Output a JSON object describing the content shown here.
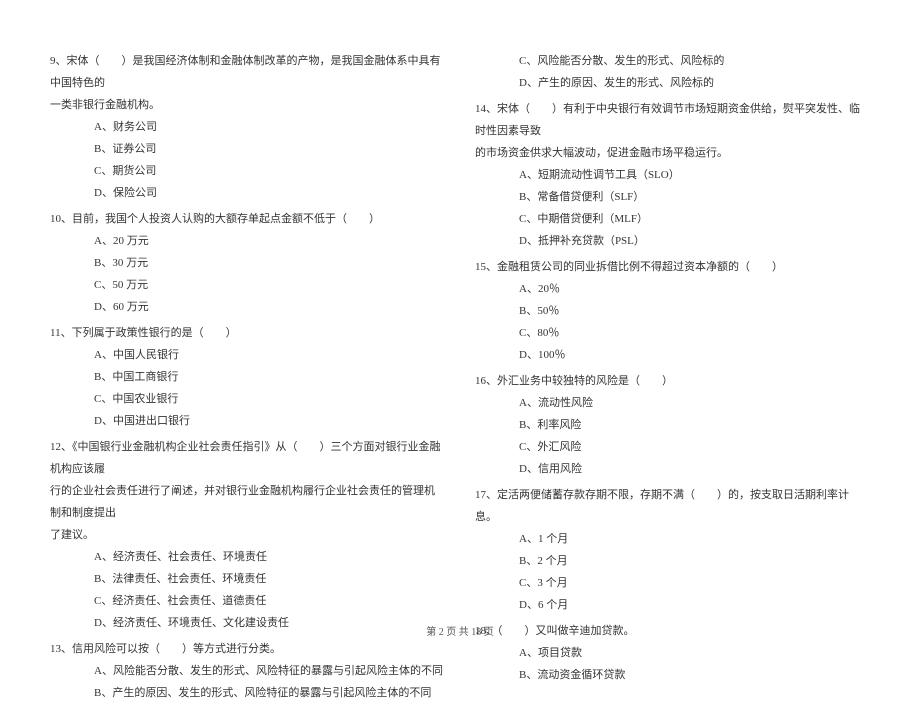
{
  "left": {
    "q9": {
      "stem": "9、宋体（　　）是我国经济体制和金融体制改革的产物，是我国金融体系中具有中国特色的",
      "stem2": "一类非银行金融机构。",
      "a": "A、财务公司",
      "b": "B、证券公司",
      "c": "C、期货公司",
      "d": "D、保险公司"
    },
    "q10": {
      "stem": "10、目前，我国个人投资人认购的大额存单起点金额不低于（　　）",
      "a": "A、20 万元",
      "b": "B、30 万元",
      "c": "C、50 万元",
      "d": "D、60 万元"
    },
    "q11": {
      "stem": "11、下列属于政策性银行的是（　　）",
      "a": "A、中国人民银行",
      "b": "B、中国工商银行",
      "c": "C、中国农业银行",
      "d": "D、中国进出口银行"
    },
    "q12": {
      "stem": "12、《中国银行业金融机构企业社会责任指引》从（　　）三个方面对银行业金融机构应该履",
      "stem2": "行的企业社会责任进行了阐述，并对银行业金融机构履行企业社会责任的管理机制和制度提出",
      "stem3": "了建议。",
      "a": "A、经济责任、社会责任、环境责任",
      "b": "B、法律责任、社会责任、环境责任",
      "c": "C、经济责任、社会责任、道德责任",
      "d": "D、经济责任、环境责任、文化建设责任"
    },
    "q13": {
      "stem": "13、信用风险可以按（　　）等方式进行分类。",
      "a": "A、风险能否分散、发生的形式、风险特征的暴露与引起风险主体的不同",
      "b": "B、产生的原因、发生的形式、风险特征的暴露与引起风险主体的不同"
    }
  },
  "right": {
    "q13c": "C、风险能否分散、发生的形式、风险标的",
    "q13d": "D、产生的原因、发生的形式、风险标的",
    "q14": {
      "stem": "14、宋体（　　）有利于中央银行有效调节市场短期资金供给，熨平突发性、临时性因素导致",
      "stem2": "的市场资金供求大幅波动，促进金融市场平稳运行。",
      "a": "A、短期流动性调节工具（SLO）",
      "b": "B、常备借贷便利（SLF）",
      "c": "C、中期借贷便利（MLF）",
      "d": "D、抵押补充贷款（PSL）"
    },
    "q15": {
      "stem": "15、金融租赁公司的同业拆借比例不得超过资本净额的（　　）",
      "a": "A、20％",
      "b": "B、50％",
      "c": "C、80％",
      "d": "D、100％"
    },
    "q16": {
      "stem": "16、外汇业务中较独特的风险是（　　）",
      "a": "A、流动性风险",
      "b": "B、利率风险",
      "c": "C、外汇风险",
      "d": "D、信用风险"
    },
    "q17": {
      "stem": "17、定活两便储蓄存款存期不限，存期不满（　　）的，按支取日活期利率计息。",
      "a": "A、1 个月",
      "b": "B、2 个月",
      "c": "C、3 个月",
      "d": "D、6 个月"
    },
    "q18": {
      "stem": "18、（　　）又叫做辛迪加贷款。",
      "a": "A、项目贷款",
      "b": "B、流动资金循环贷款"
    }
  },
  "footer": "第 2 页 共 18 页"
}
